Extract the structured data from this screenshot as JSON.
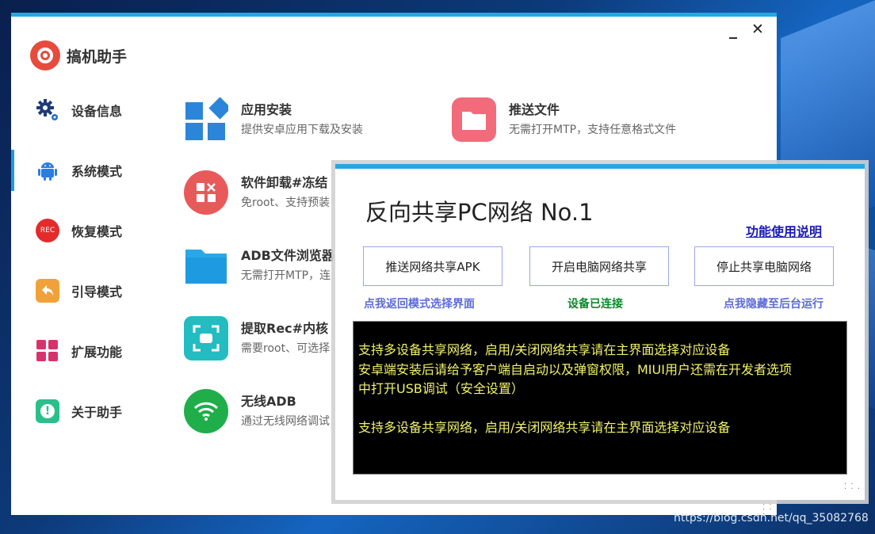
{
  "app": {
    "name": "搞机助手",
    "window_controls": {
      "minimize": "_",
      "close": "✕"
    }
  },
  "sidebar": {
    "items": [
      {
        "label": "设备信息",
        "icon": "gear-icon"
      },
      {
        "label": "系统模式",
        "icon": "android-icon",
        "active": true
      },
      {
        "label": "恢复模式",
        "icon": "rec-icon",
        "badge": "REC"
      },
      {
        "label": "引导模式",
        "icon": "back-arrow-icon"
      },
      {
        "label": "扩展功能",
        "icon": "grid-icon"
      },
      {
        "label": "关于助手",
        "icon": "info-icon"
      }
    ]
  },
  "features": [
    {
      "title": "应用安装",
      "desc": "提供安卓应用下载及安装",
      "icon": "app-install-icon"
    },
    {
      "title": "推送文件",
      "desc": "无需打开MTP，支持任意格式文件",
      "icon": "folder-icon"
    },
    {
      "title": "软件卸载#冻结",
      "desc": "免root、支持预装",
      "icon": "uninstall-icon"
    },
    {
      "title": "ADB文件浏览器",
      "desc": "无需打开MTP，连",
      "icon": "file-browser-icon"
    },
    {
      "title": "提取Rec#内核",
      "desc": "需要root、可选择",
      "icon": "scan-icon"
    },
    {
      "title": "无线ADB",
      "desc": "通过无线网络调试",
      "icon": "wifi-icon"
    }
  ],
  "dialog": {
    "title": "反向共享PC网络 No.1",
    "help_link": "功能使用说明",
    "buttons": [
      "推送网络共享APK",
      "开启电脑网络共享",
      "停止共享电脑网络"
    ],
    "back_link": "点我返回模式选择界面",
    "status": "设备已连接",
    "hide_link": "点我隐藏至后台运行",
    "console_lines": [
      "支持多设备共享网络，启用/关闭网络共享请在主界面选择对应设备",
      "安卓端安装后请给予客户端自启动以及弹窗权限，MIUI用户还需在开发者选项",
      "中打开USB调试（安全设置）",
      "",
      "支持多设备共享网络，启用/关闭网络共享请在主界面选择对应设备"
    ]
  },
  "watermark": "https://blog.csdn.net/qq_35082768",
  "colors": {
    "accent": "#27a7e0",
    "active_indicator": "#2196f3",
    "console_text": "#f1f26a",
    "status_ok": "#0a8a2a",
    "link": "#5c6bd8"
  }
}
